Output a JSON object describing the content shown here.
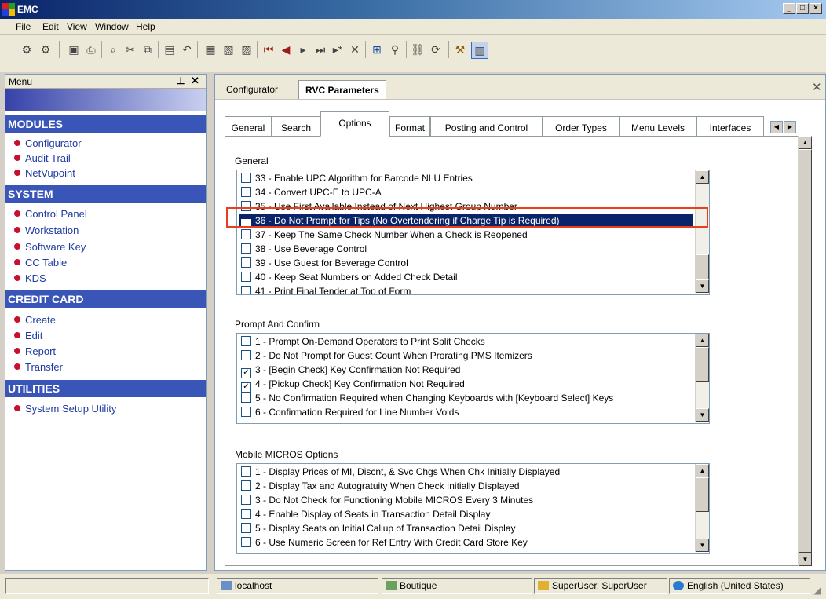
{
  "window": {
    "title": "EMC"
  },
  "menubar": [
    "File",
    "Edit",
    "View",
    "Window",
    "Help"
  ],
  "left_panel": {
    "title": "Menu",
    "sections": [
      {
        "title": "MODULES",
        "items": [
          "Configurator",
          "Audit Trail",
          "NetVupoint"
        ]
      },
      {
        "title": "SYSTEM",
        "items": [
          "Control Panel",
          "Workstation",
          "Software Key",
          "CC Table",
          "KDS"
        ]
      },
      {
        "title": "CREDIT CARD",
        "items": [
          "Create",
          "Edit",
          "Report",
          "Transfer"
        ]
      },
      {
        "title": "UTILITIES",
        "items": [
          "System Setup Utility"
        ]
      }
    ]
  },
  "doc_tabs": [
    "Configurator",
    "RVC Parameters"
  ],
  "inner_tabs": [
    "General",
    "Search",
    "Options",
    "Format",
    "Posting and Control",
    "Order Types",
    "Menu Levels",
    "Interfaces"
  ],
  "groups": [
    {
      "title": "General",
      "items": [
        {
          "label": "33 - Enable UPC Algorithm for Barcode NLU Entries",
          "checked": false
        },
        {
          "label": "34 - Convert UPC-E to UPC-A",
          "checked": false
        },
        {
          "label": "35 - Use First Available Instead of Next Highest Group Number",
          "checked": false
        },
        {
          "label": "36 - Do Not Prompt for Tips (No Overtendering if Charge Tip is Required)",
          "checked": true,
          "selected": true
        },
        {
          "label": "37 - Keep The Same Check Number When a Check is Reopened",
          "checked": false
        },
        {
          "label": "38 - Use Beverage Control",
          "checked": false
        },
        {
          "label": "39 - Use Guest for Beverage Control",
          "checked": false
        },
        {
          "label": "40 - Keep Seat Numbers on Added Check Detail",
          "checked": false
        },
        {
          "label": "41 - Print Final Tender at Top of Form",
          "checked": false
        }
      ]
    },
    {
      "title": "Prompt And Confirm",
      "items": [
        {
          "label": "1 - Prompt On-Demand Operators to Print Split Checks",
          "checked": false
        },
        {
          "label": "2 - Do Not Prompt for Guest Count When Prorating PMS Itemizers",
          "checked": false
        },
        {
          "label": "3 - [Begin Check] Key Confirmation Not Required",
          "checked": true
        },
        {
          "label": "4 - [Pickup Check] Key Confirmation Not Required",
          "checked": true
        },
        {
          "label": "5 - No Confirmation Required when Changing Keyboards with [Keyboard Select] Keys",
          "checked": false
        },
        {
          "label": "6 - Confirmation Required for Line Number Voids",
          "checked": false
        }
      ]
    },
    {
      "title": "Mobile MICROS Options",
      "items": [
        {
          "label": "1 - Display Prices of MI, Discnt, & Svc Chgs When Chk Initially Displayed",
          "checked": false
        },
        {
          "label": "2 - Display Tax and Autogratuity When Check Initially Displayed",
          "checked": false
        },
        {
          "label": "3 - Do Not Check for Functioning Mobile MICROS Every 3 Minutes",
          "checked": false
        },
        {
          "label": "4 - Enable Display of Seats in Transaction Detail Display",
          "checked": false
        },
        {
          "label": "5 - Display Seats on Initial Callup of Transaction Detail Display",
          "checked": false
        },
        {
          "label": "6 - Use Numeric Screen for Ref Entry With Credit Card Store Key",
          "checked": false
        }
      ]
    }
  ],
  "status": {
    "server": "localhost",
    "store": "Boutique",
    "user": "SuperUser, SuperUser",
    "language": "English (United States)"
  }
}
